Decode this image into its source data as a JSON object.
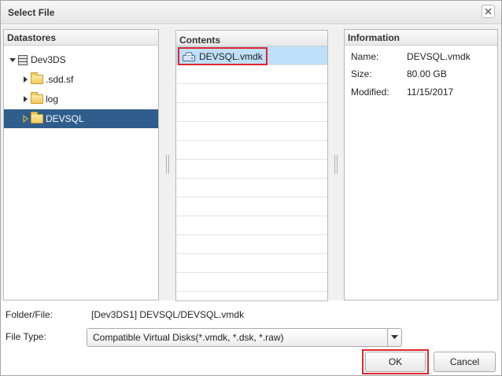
{
  "dialog": {
    "title": "Select File"
  },
  "datastores": {
    "header": "Datastores",
    "items": [
      {
        "label": "Dev3DS",
        "expanded": true,
        "selected": false
      },
      {
        "label": ".sdd.sf",
        "expanded": false,
        "selected": false
      },
      {
        "label": "log",
        "expanded": false,
        "selected": false
      },
      {
        "label": "DEVSQL",
        "expanded": false,
        "selected": true
      }
    ]
  },
  "contents": {
    "header": "Contents",
    "files": [
      {
        "name": "DEVSQL.vmdk",
        "selected": true
      }
    ]
  },
  "information": {
    "header": "Information",
    "rows": [
      {
        "label": "Name:",
        "value": "DEVSQL.vmdk"
      },
      {
        "label": "Size:",
        "value": "80.00 GB"
      },
      {
        "label": "Modified:",
        "value": "11/15/2017"
      }
    ]
  },
  "footer": {
    "folder_file_label": "Folder/File:",
    "folder_file_value": "[Dev3DS1] DEVSQL/DEVSQL.vmdk",
    "file_type_label": "File Type:",
    "file_type_value": "Compatible Virtual Disks(*.vmdk, *.dsk, *.raw)",
    "ok_label": "OK",
    "cancel_label": "Cancel"
  },
  "colors": {
    "selection_dark": "#2f5e8c",
    "selection_light": "#bfe0f8",
    "highlight_red": "#e0262b"
  }
}
